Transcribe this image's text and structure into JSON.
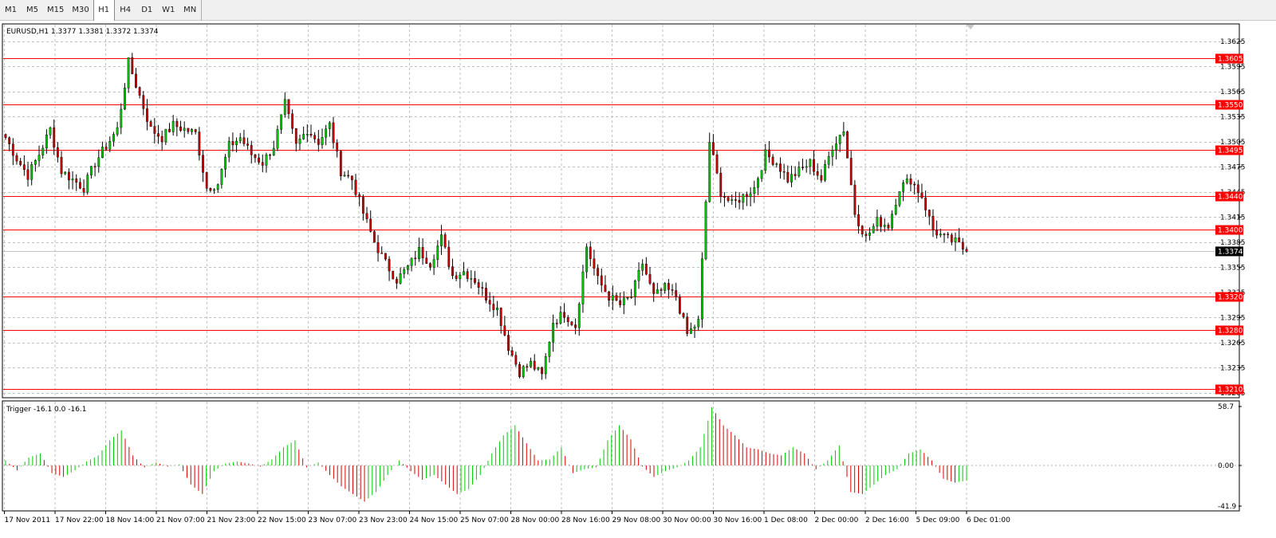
{
  "toolbar": {
    "timeframes": [
      {
        "label": "M1",
        "active": false
      },
      {
        "label": "M5",
        "active": false
      },
      {
        "label": "M15",
        "active": false
      },
      {
        "label": "M30",
        "active": false
      },
      {
        "label": "H1",
        "active": true
      },
      {
        "label": "H4",
        "active": false
      },
      {
        "label": "D1",
        "active": false
      },
      {
        "label": "W1",
        "active": false
      },
      {
        "label": "MN",
        "active": false
      }
    ]
  },
  "chart_data": [
    {
      "type": "candlestick",
      "title": "EURUSD,H1  1.3377 1.3381 1.3372 1.3374",
      "symbol": "EURUSD",
      "timeframe": "H1",
      "ohlc_last": {
        "open": 1.3377,
        "high": 1.3381,
        "low": 1.3372,
        "close": 1.3374
      },
      "current_price_label": "1.3374",
      "ylim": [
        1.32,
        1.3645
      ],
      "y_ticks": [
        "1.3625",
        "1.3595",
        "1.3565",
        "1.3535",
        "1.3505",
        "1.3475",
        "1.3445",
        "1.3415",
        "1.3385",
        "1.3355",
        "1.3325",
        "1.3295",
        "1.3265",
        "1.3235",
        "1.3205"
      ],
      "horizontal_lines": [
        {
          "price": 1.3605,
          "label": "1.3605"
        },
        {
          "price": 1.355,
          "label": "1.3550"
        },
        {
          "price": 1.3495,
          "label": "1.3495"
        },
        {
          "price": 1.344,
          "label": "1.3440"
        },
        {
          "price": 1.34,
          "label": "1.3400"
        },
        {
          "price": 1.332,
          "label": "1.3320"
        },
        {
          "price": 1.328,
          "label": "1.3280"
        },
        {
          "price": 1.321,
          "label": "1.3210"
        }
      ],
      "x_labels": [
        "17 Nov 2011",
        "17 Nov 22:00",
        "18 Nov 14:00",
        "21 Nov 07:00",
        "21 Nov 23:00",
        "22 Nov 15:00",
        "23 Nov 07:00",
        "23 Nov 23:00",
        "24 Nov 15:00",
        "25 Nov 07:00",
        "28 Nov 00:00",
        "28 Nov 16:00",
        "29 Nov 08:00",
        "30 Nov 00:00",
        "30 Nov 16:00",
        "1 Dec 08:00",
        "2 Dec 00:00",
        "2 Dec 16:00",
        "5 Dec 09:00",
        "6 Dec 01:00"
      ],
      "close_series": [
        1.351,
        1.3485,
        1.3465,
        1.349,
        1.352,
        1.347,
        1.346,
        1.345,
        1.348,
        1.35,
        1.352,
        1.36,
        1.356,
        1.352,
        1.351,
        1.3525,
        1.352,
        1.3515,
        1.345,
        1.3455,
        1.35,
        1.351,
        1.349,
        1.348,
        1.35,
        1.355,
        1.35,
        1.352,
        1.3505,
        1.3525,
        1.347,
        1.346,
        1.342,
        1.3385,
        1.336,
        1.334,
        1.3355,
        1.3375,
        1.336,
        1.339,
        1.3345,
        1.335,
        1.334,
        1.332,
        1.3305,
        1.326,
        1.323,
        1.324,
        1.3225,
        1.329,
        1.33,
        1.3285,
        1.338,
        1.334,
        1.332,
        1.331,
        1.332,
        1.336,
        1.332,
        1.333,
        1.332,
        1.3275,
        1.329,
        1.3505,
        1.3445,
        1.343,
        1.344,
        1.345,
        1.349,
        1.348,
        1.346,
        1.347,
        1.348,
        1.346,
        1.35,
        1.352,
        1.342,
        1.339,
        1.341,
        1.3405,
        1.345,
        1.346,
        1.344,
        1.34,
        1.339,
        1.3385,
        1.3374
      ],
      "indicator": {
        "name": "Trigger",
        "label": "Trigger -16.1 0.0 -16.1",
        "ylim": [
          -41.9,
          58.7
        ],
        "y_ticks": [
          "58.7",
          "0.00",
          "-41.9"
        ],
        "up_color": "#00cc00",
        "down_color": "#dd0000",
        "values": [
          5,
          -5,
          8,
          12,
          -8,
          -12,
          -5,
          4,
          10,
          25,
          35,
          10,
          -2,
          3,
          -1,
          1,
          -20,
          -30,
          -6,
          2,
          4,
          2,
          -1,
          6,
          18,
          25,
          -2,
          3,
          -10,
          -22,
          -30,
          -38,
          -28,
          -10,
          5,
          -6,
          -15,
          -10,
          -20,
          -30,
          -25,
          -10,
          12,
          30,
          40,
          22,
          5,
          6,
          18,
          -8,
          -4,
          -2,
          25,
          40,
          26,
          -1,
          -12,
          -6,
          -2,
          5,
          18,
          58,
          40,
          30,
          18,
          16,
          12,
          10,
          18,
          12,
          -4,
          5,
          20,
          -28,
          -30,
          -20,
          -10,
          -4,
          12,
          16,
          5,
          -14,
          -18,
          -16
        ]
      },
      "colors": {
        "bull": "#00c800",
        "bear": "#c80000",
        "wick": "#000000",
        "level_line": "#ff0000",
        "level_label_bg": "#ff0000",
        "grid": "#c0c0c0"
      }
    }
  ]
}
